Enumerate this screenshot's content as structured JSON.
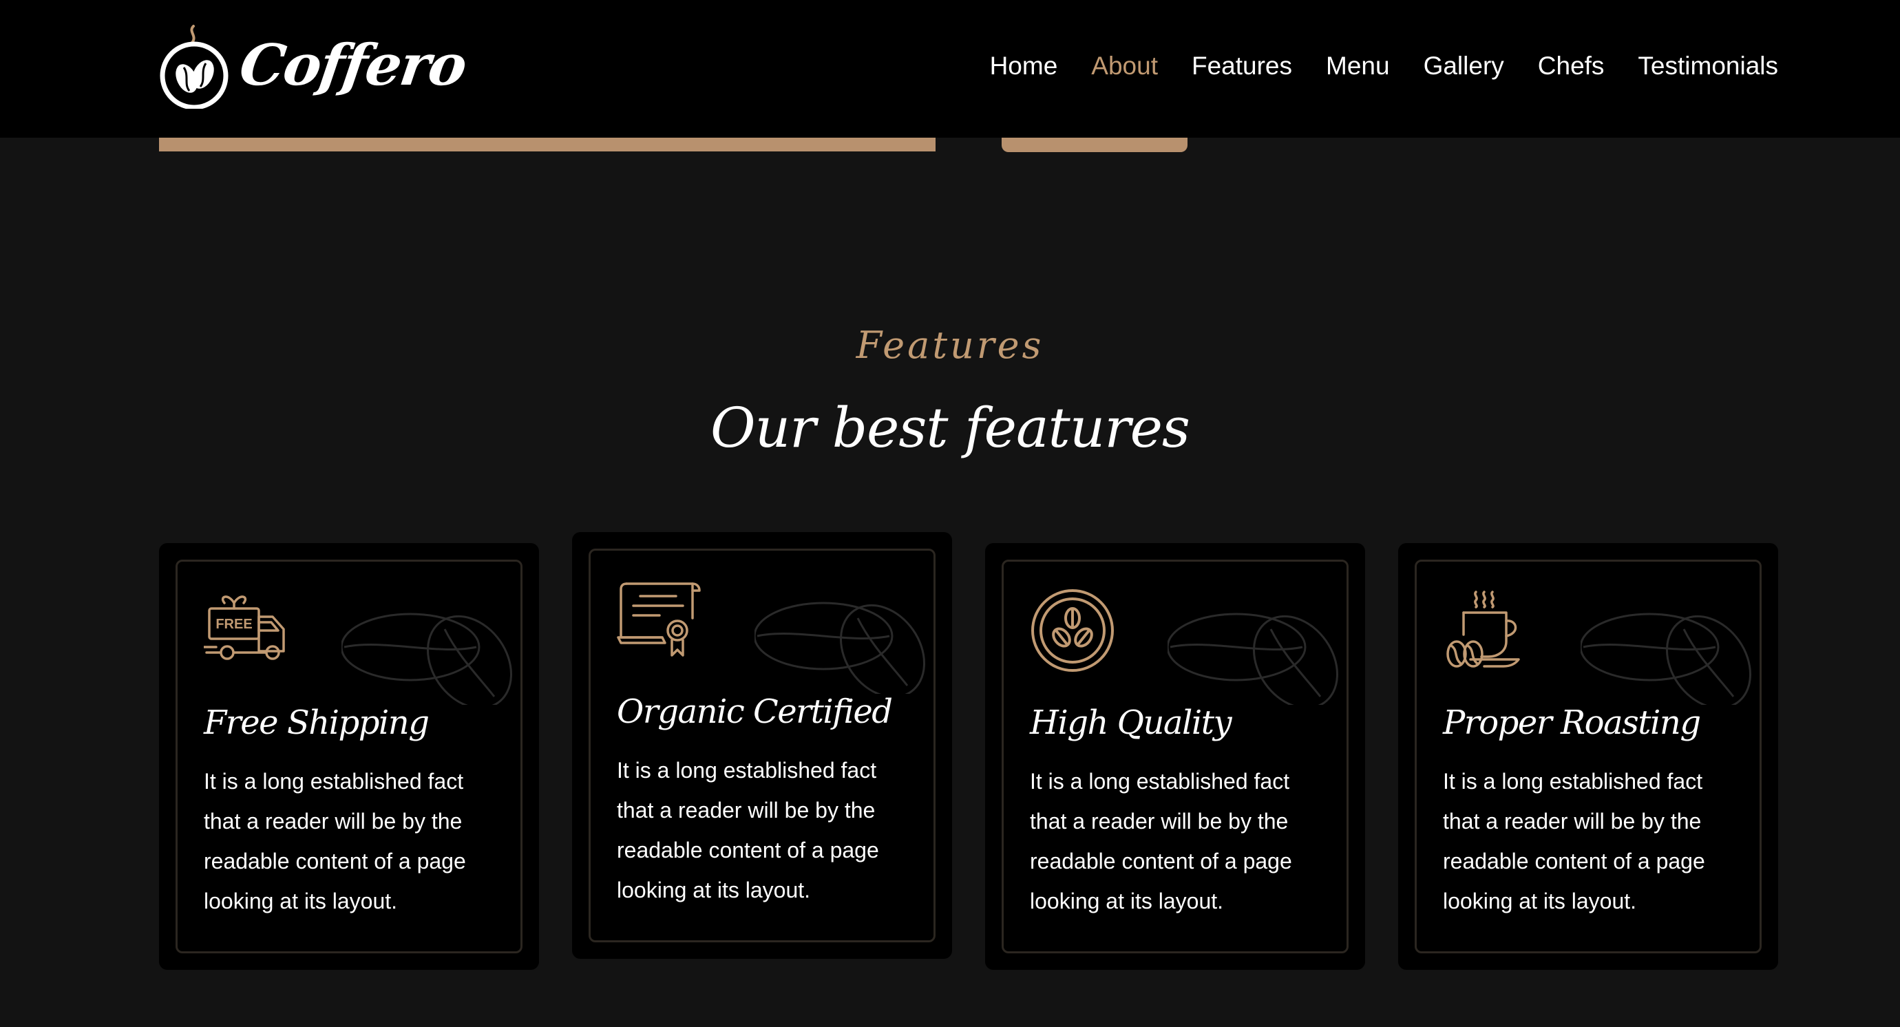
{
  "brand": {
    "name": "Coffero",
    "accent_color": "#c19a72",
    "background_color": "#131313"
  },
  "nav": {
    "items": [
      {
        "label": "Home",
        "active": false
      },
      {
        "label": "About",
        "active": true
      },
      {
        "label": "Features",
        "active": false
      },
      {
        "label": "Menu",
        "active": false
      },
      {
        "label": "Gallery",
        "active": false
      },
      {
        "label": "Chefs",
        "active": false
      },
      {
        "label": "Testimonials",
        "active": false
      }
    ]
  },
  "features_section": {
    "subtitle": "Features",
    "title": "Our best features",
    "cards": [
      {
        "icon": "free-shipping-truck-icon",
        "title": "Free Shipping",
        "text": "It is a long established fact that a reader will be by the readable content of a page looking at its layout.",
        "icon_text": "FREE"
      },
      {
        "icon": "certificate-icon",
        "title": "Organic Certified",
        "text": "It is a long established fact that a reader will be by the readable content of a page looking at its layout.",
        "highlighted": true
      },
      {
        "icon": "coffee-beans-circle-icon",
        "title": "High Quality",
        "text": "It is a long established fact that a reader will be by the readable content of a page looking at its layout."
      },
      {
        "icon": "coffee-cup-icon",
        "title": "Proper Roasting",
        "text": "It is a long established fact that a reader will be by the readable content of a page looking at its layout."
      }
    ]
  }
}
